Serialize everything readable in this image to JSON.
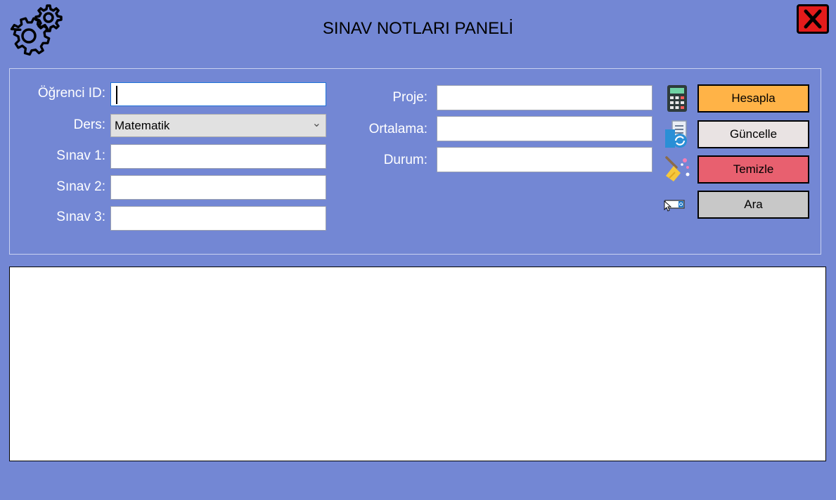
{
  "header": {
    "title": "SINAV NOTLARI PANELİ",
    "close_icon": "close-icon",
    "settings_icon": "gears-icon"
  },
  "form": {
    "ogrenci_id": {
      "label": "Öğrenci ID:",
      "value": ""
    },
    "ders": {
      "label": "Ders:",
      "value": "Matematik"
    },
    "sinav1": {
      "label": "Sınav 1:",
      "value": ""
    },
    "sinav2": {
      "label": "Sınav 2:",
      "value": ""
    },
    "sinav3": {
      "label": "Sınav 3:",
      "value": ""
    },
    "proje": {
      "label": "Proje:",
      "value": ""
    },
    "ortalama": {
      "label": "Ortalama:",
      "value": ""
    },
    "durum": {
      "label": "Durum:",
      "value": ""
    }
  },
  "actions": {
    "hesapla": {
      "label": "Hesapla",
      "color": "#ffb347",
      "icon": "calculator-icon"
    },
    "guncelle": {
      "label": "Güncelle",
      "color": "#e9e3e3",
      "icon": "document-refresh-icon"
    },
    "temizle": {
      "label": "Temizle",
      "color": "#e8606f",
      "icon": "broom-icon"
    },
    "ara": {
      "label": "Ara",
      "color": "#c8c8c8",
      "icon": "search-field-icon"
    }
  },
  "colors": {
    "background": "#7387d4",
    "close": "#e41b1b"
  }
}
